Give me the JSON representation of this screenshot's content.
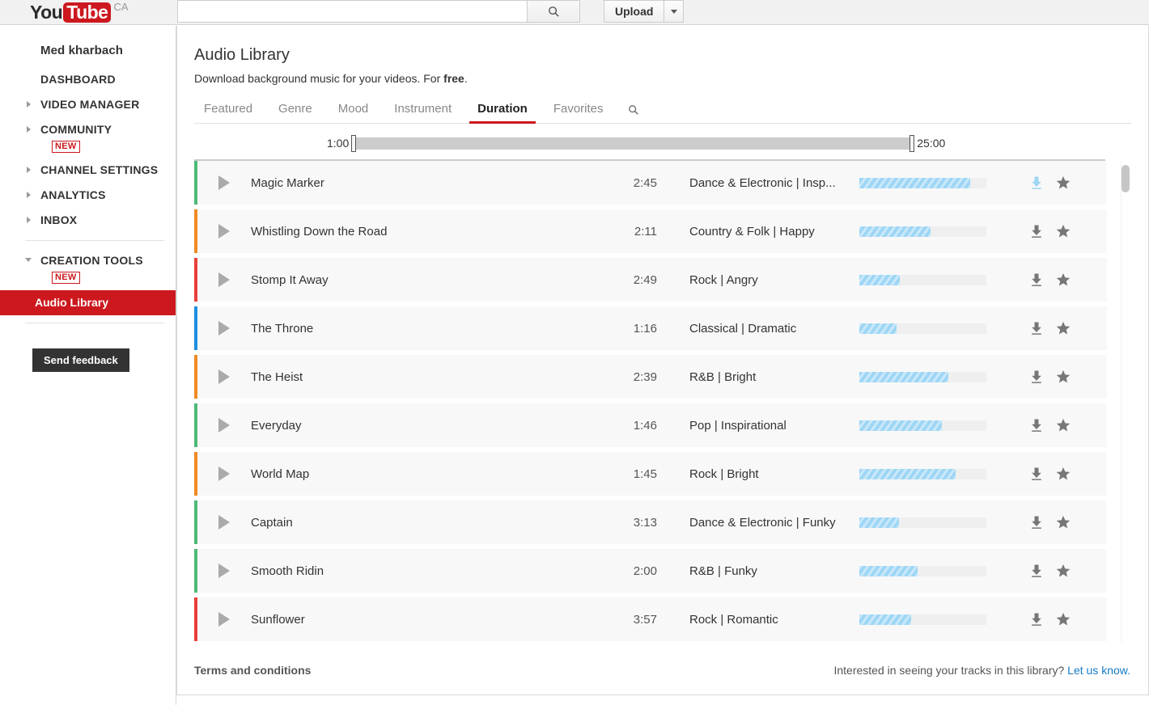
{
  "topbar": {
    "logo_you": "You",
    "logo_tube": "Tube",
    "logo_country": "CA",
    "search_value": "",
    "search_placeholder": "",
    "search_icon": "search-icon",
    "upload_label": "Upload",
    "upload_caret_icon": "chevron-down-icon"
  },
  "sidebar": {
    "channel_name": "Med kharbach",
    "items": [
      {
        "label": "DASHBOARD",
        "arrow": false,
        "badge": null
      },
      {
        "label": "VIDEO MANAGER",
        "arrow": true,
        "badge": null
      },
      {
        "label": "COMMUNITY",
        "arrow": true,
        "badge": "NEW"
      },
      {
        "label": "CHANNEL SETTINGS",
        "arrow": true,
        "badge": null
      },
      {
        "label": "ANALYTICS",
        "arrow": true,
        "badge": null
      },
      {
        "label": "INBOX",
        "arrow": true,
        "badge": null
      },
      {
        "label": "CREATION TOOLS",
        "arrow": true,
        "expanded": true,
        "badge": "NEW"
      }
    ],
    "active_sub_item": "Audio Library",
    "feedback_label": "Send feedback"
  },
  "main": {
    "title": "Audio Library",
    "subtitle_prefix": "Download background music for your videos. For ",
    "subtitle_bold": "free",
    "subtitle_suffix": ".",
    "tabs": [
      {
        "label": "Featured",
        "active": false
      },
      {
        "label": "Genre",
        "active": false
      },
      {
        "label": "Mood",
        "active": false
      },
      {
        "label": "Instrument",
        "active": false
      },
      {
        "label": "Duration",
        "active": true
      },
      {
        "label": "Favorites",
        "active": false
      }
    ],
    "tab_search_icon": "search-icon",
    "duration_filter": {
      "min_label": "1:00",
      "max_label": "25:00"
    },
    "accent_color": "#cc181e",
    "bar_fill_color": "#9ed6f5"
  },
  "tracks": [
    {
      "title": "Magic Marker",
      "duration": "2:45",
      "tags": "Dance & Electronic | Insp...",
      "popularity": 87,
      "stripe": "#4cbb75",
      "download_icon": "download-icon",
      "download_active": true,
      "star_icon": "star-icon"
    },
    {
      "title": "Whistling Down the Road",
      "duration": "2:11",
      "tags": "Country & Folk | Happy",
      "popularity": 56,
      "stripe": "#f08a24",
      "download_icon": "download-icon",
      "download_active": false,
      "star_icon": "star-icon"
    },
    {
      "title": "Stomp It Away",
      "duration": "2:49",
      "tags": "Rock | Angry",
      "popularity": 32,
      "stripe": "#e8403a",
      "download_icon": "download-icon",
      "download_active": false,
      "star_icon": "star-icon"
    },
    {
      "title": "The Throne",
      "duration": "1:16",
      "tags": "Classical | Dramatic",
      "popularity": 29,
      "stripe": "#1e90e0",
      "download_icon": "download-icon",
      "download_active": false,
      "star_icon": "star-icon"
    },
    {
      "title": "The Heist",
      "duration": "2:39",
      "tags": "R&B | Bright",
      "popularity": 70,
      "stripe": "#f08a24",
      "download_icon": "download-icon",
      "download_active": false,
      "star_icon": "star-icon"
    },
    {
      "title": "Everyday",
      "duration": "1:46",
      "tags": "Pop | Inspirational",
      "popularity": 65,
      "stripe": "#4cbb75",
      "download_icon": "download-icon",
      "download_active": false,
      "star_icon": "star-icon"
    },
    {
      "title": "World Map",
      "duration": "1:45",
      "tags": "Rock | Bright",
      "popularity": 76,
      "stripe": "#f08a24",
      "download_icon": "download-icon",
      "download_active": false,
      "star_icon": "star-icon"
    },
    {
      "title": "Captain",
      "duration": "3:13",
      "tags": "Dance & Electronic | Funky",
      "popularity": 31,
      "stripe": "#4cbb75",
      "download_icon": "download-icon",
      "download_active": false,
      "star_icon": "star-icon"
    },
    {
      "title": "Smooth Ridin",
      "duration": "2:00",
      "tags": "R&B | Funky",
      "popularity": 46,
      "stripe": "#4cbb75",
      "download_icon": "download-icon",
      "download_active": false,
      "star_icon": "star-icon"
    },
    {
      "title": "Sunflower",
      "duration": "3:57",
      "tags": "Rock | Romantic",
      "popularity": 41,
      "stripe": "#e8403a",
      "download_icon": "download-icon",
      "download_active": false,
      "star_icon": "star-icon"
    }
  ],
  "footer": {
    "terms_label": "Terms and conditions",
    "interested_text": "Interested in seeing your tracks in this library? ",
    "let_us_know_label": "Let us know."
  }
}
